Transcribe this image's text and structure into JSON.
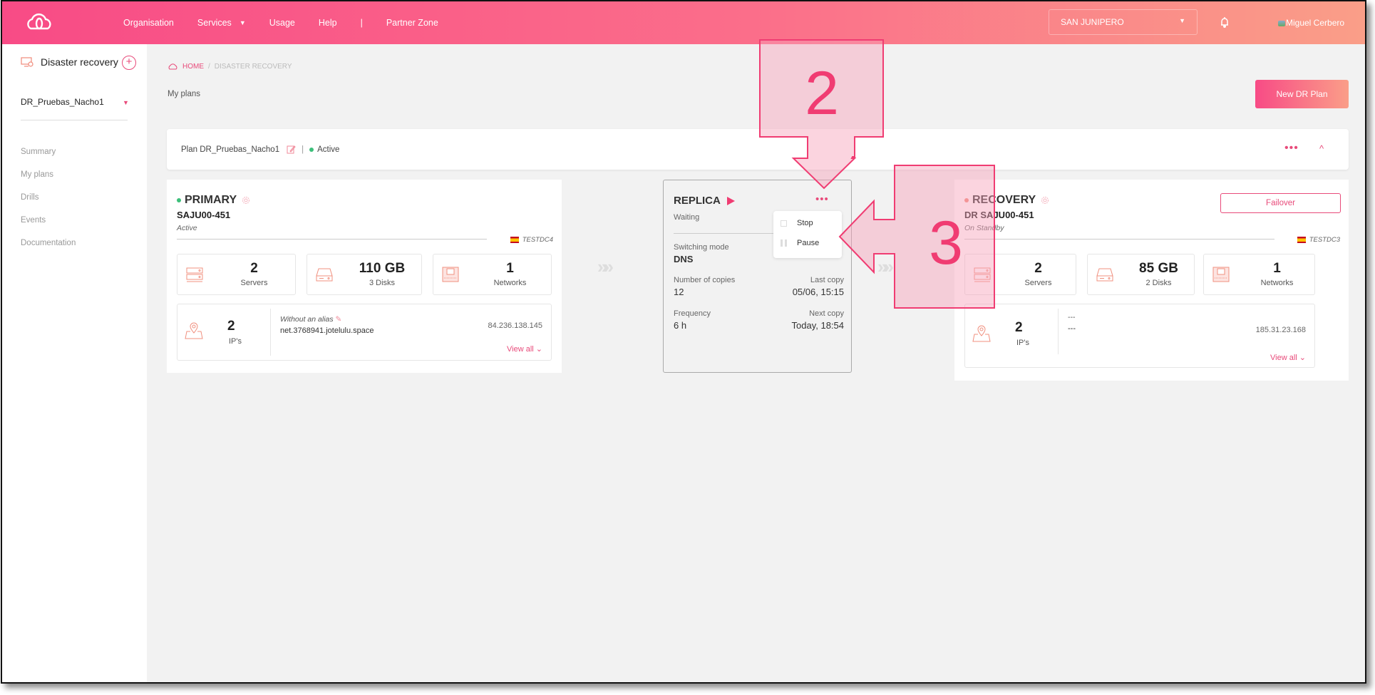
{
  "header": {
    "logo_icon": "cloud-logo-icon",
    "nav": [
      "Organisation",
      "Services",
      "Usage",
      "Help",
      "Partner Zone"
    ],
    "services_caret": "▼",
    "separator": "|",
    "org_selector": "SAN JUNIPERO",
    "org_selector_caret": "▼",
    "notification_icon": "bell-icon",
    "user_name": "Miguel Cerbero"
  },
  "sidebar": {
    "title": "Disaster recovery",
    "add_label": "+",
    "selected_plan": "DR_Pruebas_Nacho1",
    "plan_caret": "▼",
    "menu": [
      "Summary",
      "My plans",
      "Drills",
      "Events",
      "Documentation"
    ]
  },
  "breadcrumb": {
    "home": "HOME",
    "sep": "/",
    "current": "DISASTER RECOVERY"
  },
  "page": {
    "subtitle": "My plans",
    "new_plan_button": "New DR Plan"
  },
  "plan": {
    "name": "Plan DR_Pruebas_Nacho1",
    "sep": "|",
    "status": "Active",
    "status_color": "#3cbf7a",
    "more": "•••",
    "collapse": "^"
  },
  "primary": {
    "title": "PRIMARY",
    "status_color": "#3cbf7a",
    "host": "SAJU00-451",
    "state": "Active",
    "datacenter": "TESTDC4",
    "stats": [
      {
        "value": "2",
        "label": "Servers",
        "icon": "servers-icon"
      },
      {
        "value": "110 GB",
        "label": "3 Disks",
        "icon": "disk-icon"
      },
      {
        "value": "1",
        "label": "Networks",
        "icon": "network-icon"
      }
    ],
    "ips": {
      "value": "2",
      "label": "IP's",
      "alias": "Without an alias",
      "domain": "net.3768941.jotelulu.space",
      "ip": "84.236.138.145",
      "view_all": "View all ⌄"
    }
  },
  "replica": {
    "title": "REPLICA",
    "state": "Waiting",
    "more": "•••",
    "switching_mode_label": "Switching mode",
    "switching_mode": "DNS",
    "copies_label": "Number of copies",
    "copies": "12",
    "last_copy_label": "Last copy",
    "last_copy": "05/06, 15:15",
    "frequency_label": "Frequency",
    "frequency": "6 h",
    "next_copy_label": "Next copy",
    "next_copy": "Today, 18:54",
    "menu": [
      {
        "label": "Stop",
        "icon": "stop-icon"
      },
      {
        "label": "Pause",
        "icon": "pause-icon"
      }
    ]
  },
  "recovery": {
    "title": "RECOVERY",
    "status_color": "#f08a7a",
    "host": "DR SAJU00-451",
    "state": "On Standby",
    "datacenter": "TESTDC3",
    "failover_button": "Failover",
    "stats": [
      {
        "value": "2",
        "label": "Servers",
        "icon": "servers-icon"
      },
      {
        "value": "85 GB",
        "label": "2 Disks",
        "icon": "disk-icon"
      },
      {
        "value": "1",
        "label": "Networks",
        "icon": "network-icon"
      }
    ],
    "ips": {
      "value": "2",
      "label": "IP's",
      "alias": "---",
      "domain": "---",
      "ip": "185.31.23.168",
      "view_all": "View all ⌄"
    }
  },
  "flow_chevrons": "»»",
  "annotations": [
    {
      "label": "2"
    },
    {
      "label": "3"
    }
  ],
  "colors": {
    "accent": "#e84a7a",
    "header_start": "#f84b86",
    "header_end": "#fa9e88",
    "annotation": "#f03c72"
  }
}
